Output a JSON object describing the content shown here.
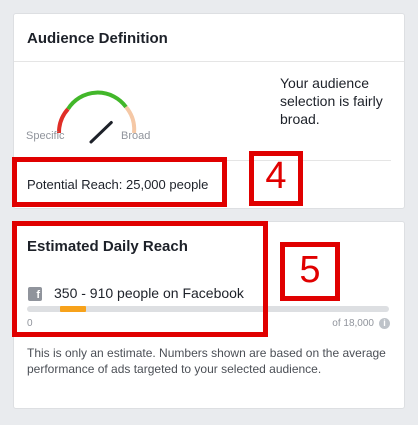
{
  "audience_card": {
    "title": "Audience Definition",
    "gauge": {
      "left_label": "Specific",
      "right_label": "Broad",
      "level": 0.72,
      "colors": {
        "specific": "#e02e27",
        "mid": "#42b72a",
        "broad": "#f5c8a6",
        "needle": "#1d2129"
      }
    },
    "description": "Your audience selection is fairly broad.",
    "potential_reach": "Potential Reach: 25,000 people"
  },
  "daily_card": {
    "title": "Estimated Daily Reach",
    "network_icon": "facebook-icon",
    "range_text": "350 - 910 people on Facebook",
    "range_min": 350,
    "range_max": 910,
    "scale_min": "0",
    "scale_max": "of 18,000",
    "scale_total": 18000,
    "info_icon": "info-icon",
    "note": "This is only an estimate. Numbers shown are based on the average performance of ads targeted to your selected audience.",
    "bar_color": "#f7a21b"
  },
  "annotations": {
    "label_4": "4",
    "label_5": "5",
    "color": "#e00000"
  }
}
